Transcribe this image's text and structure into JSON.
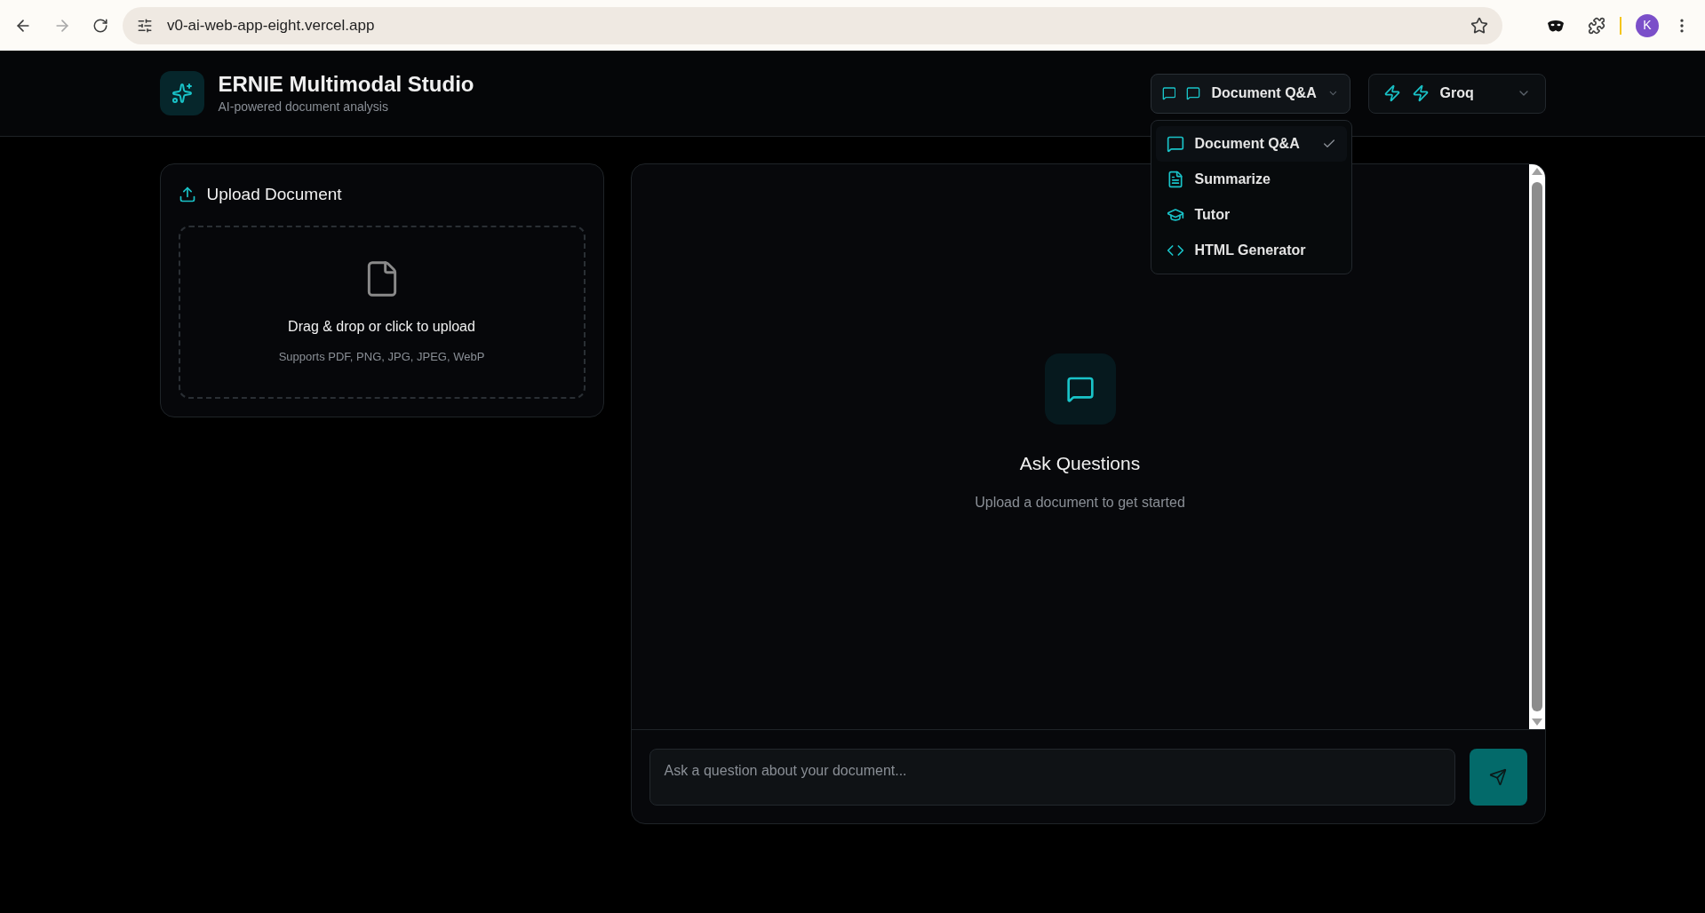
{
  "browser": {
    "url": "v0-ai-web-app-eight.vercel.app",
    "profile_initial": "K"
  },
  "header": {
    "title": "ERNIE Multimodal Studio",
    "subtitle": "AI-powered document analysis"
  },
  "mode_select": {
    "label": "Document Q&A",
    "kind": "chat",
    "expanded": true
  },
  "model_select": {
    "label": "Groq"
  },
  "mode_menu": [
    {
      "label": "Document Q&A",
      "kind": "chat",
      "selected": true
    },
    {
      "label": "Summarize",
      "kind": "file",
      "selected": false
    },
    {
      "label": "Tutor",
      "kind": "tutor",
      "selected": false
    },
    {
      "label": "HTML Generator",
      "kind": "code",
      "selected": false
    }
  ],
  "upload": {
    "title": "Upload Document",
    "prompt": "Drag & drop or click to upload",
    "formats": "Supports PDF, PNG, JPG, JPEG, WebP"
  },
  "chat": {
    "empty_title": "Ask Questions",
    "empty_subtitle": "Upload a document to get started",
    "input": {
      "placeholder": "Ask a question about your document..."
    }
  }
}
